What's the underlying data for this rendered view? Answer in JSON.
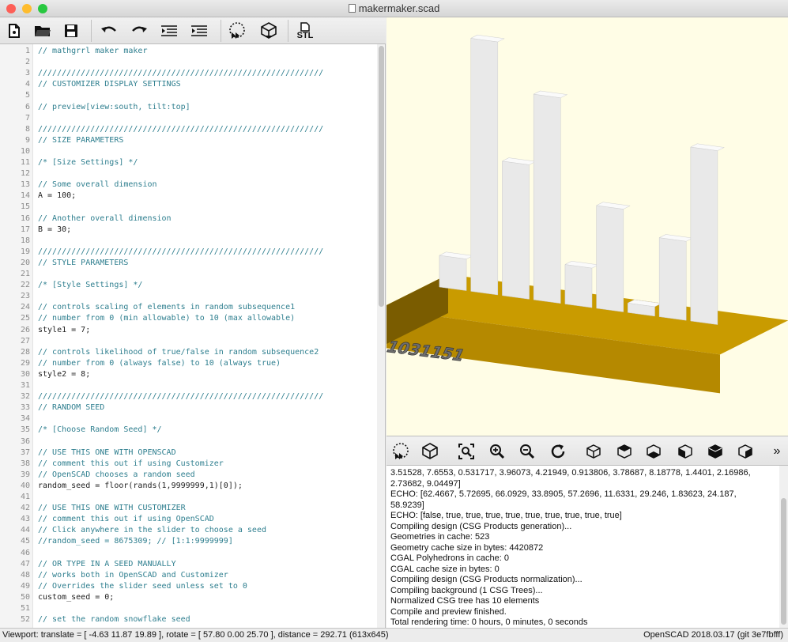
{
  "window": {
    "title": "makermaker.scad"
  },
  "colors": {
    "viewport_bg": "#fffde6",
    "base": "#c99b00",
    "bars": "#e6e6e6",
    "close": "#fd5f57",
    "minimize": "#febc2e",
    "zoom": "#28c840"
  },
  "editor_toolbar": {
    "icons": [
      "new-file-icon",
      "open-folder-icon",
      "save-icon",
      "undo-icon",
      "redo-icon",
      "unindent-icon",
      "indent-icon",
      "preview-icon",
      "render-icon",
      "export-stl-icon"
    ],
    "stl_label": "STL"
  },
  "editor": {
    "lines": [
      {
        "n": "1",
        "t": "// mathgrrl maker maker",
        "k": "comment"
      },
      {
        "n": "2",
        "t": "",
        "k": "plain"
      },
      {
        "n": "3",
        "t": "////////////////////////////////////////////////////////////",
        "k": "comment"
      },
      {
        "n": "4",
        "t": "// CUSTOMIZER DISPLAY SETTINGS",
        "k": "comment"
      },
      {
        "n": "5",
        "t": "",
        "k": "plain"
      },
      {
        "n": "6",
        "t": "// preview[view:south, tilt:top]",
        "k": "comment"
      },
      {
        "n": "7",
        "t": "",
        "k": "plain"
      },
      {
        "n": "8",
        "t": "////////////////////////////////////////////////////////////",
        "k": "comment"
      },
      {
        "n": "9",
        "t": "// SIZE PARAMETERS",
        "k": "comment"
      },
      {
        "n": "10",
        "t": "",
        "k": "plain"
      },
      {
        "n": "11",
        "t": "/* [Size Settings] */",
        "k": "comment"
      },
      {
        "n": "12",
        "t": "",
        "k": "plain"
      },
      {
        "n": "13",
        "t": "// Some overall dimension",
        "k": "comment"
      },
      {
        "n": "14",
        "t": "A = 100;",
        "k": "plain"
      },
      {
        "n": "15",
        "t": "",
        "k": "plain"
      },
      {
        "n": "16",
        "t": "// Another overall dimension",
        "k": "comment"
      },
      {
        "n": "17",
        "t": "B = 30;",
        "k": "plain"
      },
      {
        "n": "18",
        "t": "",
        "k": "plain"
      },
      {
        "n": "19",
        "t": "////////////////////////////////////////////////////////////",
        "k": "comment"
      },
      {
        "n": "20",
        "t": "// STYLE PARAMETERS",
        "k": "comment"
      },
      {
        "n": "21",
        "t": "",
        "k": "plain"
      },
      {
        "n": "22",
        "t": "/* [Style Settings] */",
        "k": "comment"
      },
      {
        "n": "23",
        "t": "",
        "k": "plain"
      },
      {
        "n": "24",
        "t": "// controls scaling of elements in random subsequence1",
        "k": "comment"
      },
      {
        "n": "25",
        "t": "// number from 0 (min allowable) to 10 (max allowable)",
        "k": "comment"
      },
      {
        "n": "26",
        "t": "style1 = 7;",
        "k": "plain"
      },
      {
        "n": "27",
        "t": "",
        "k": "plain"
      },
      {
        "n": "28",
        "t": "// controls likelihood of true/false in random subsequence2",
        "k": "comment"
      },
      {
        "n": "29",
        "t": "// number from 0 (always false) to 10 (always true)",
        "k": "comment"
      },
      {
        "n": "30",
        "t": "style2 = 8;",
        "k": "plain"
      },
      {
        "n": "31",
        "t": "",
        "k": "plain"
      },
      {
        "n": "32",
        "t": "////////////////////////////////////////////////////////////",
        "k": "comment"
      },
      {
        "n": "33",
        "t": "// RANDOM SEED",
        "k": "comment"
      },
      {
        "n": "34",
        "t": "",
        "k": "plain"
      },
      {
        "n": "35",
        "t": "/* [Choose Random Seed] */",
        "k": "comment"
      },
      {
        "n": "36",
        "t": "",
        "k": "plain"
      },
      {
        "n": "37",
        "t": "// USE THIS ONE WITH OPENSCAD",
        "k": "comment"
      },
      {
        "n": "38",
        "t": "// comment this out if using Customizer",
        "k": "comment"
      },
      {
        "n": "39",
        "t": "// OpenSCAD chooses a random seed",
        "k": "comment"
      },
      {
        "n": "40",
        "t": "random_seed = floor(rands(1,9999999,1)[0]);",
        "k": "plain"
      },
      {
        "n": "41",
        "t": "",
        "k": "plain"
      },
      {
        "n": "42",
        "t": "// USE THIS ONE WITH CUSTOMIZER",
        "k": "comment"
      },
      {
        "n": "43",
        "t": "// comment this out if using OpenSCAD",
        "k": "comment"
      },
      {
        "n": "44",
        "t": "// Click anywhere in the slider to choose a seed",
        "k": "comment"
      },
      {
        "n": "45",
        "t": "//random_seed = 8675309; // [1:1:9999999]",
        "k": "comment"
      },
      {
        "n": "46",
        "t": "",
        "k": "plain"
      },
      {
        "n": "47",
        "t": "// OR TYPE IN A SEED MANUALLY",
        "k": "comment"
      },
      {
        "n": "48",
        "t": "// works both in OpenSCAD and Customizer",
        "k": "comment"
      },
      {
        "n": "49",
        "t": "// Overrides the slider seed unless set to 0",
        "k": "comment"
      },
      {
        "n": "50",
        "t": "custom_seed = 0;",
        "k": "plain"
      },
      {
        "n": "51",
        "t": "",
        "k": "plain"
      },
      {
        "n": "52",
        "t": "// set the random snowflake seed",
        "k": "comment"
      }
    ]
  },
  "viewport": {
    "seed_label": "1031151",
    "bar_heights": [
      2,
      16,
      8.5,
      13,
      2.5,
      6.5,
      0.6,
      5,
      11
    ]
  },
  "viewport_toolbar": {
    "icons": [
      "preview-icon",
      "render-icon",
      "view-all-icon",
      "zoom-in-icon",
      "zoom-out-icon",
      "reset-view-icon",
      "view-right-icon",
      "view-top-icon",
      "view-bottom-icon",
      "view-left-icon",
      "view-front-icon",
      "view-back-icon"
    ],
    "more": "»"
  },
  "console": {
    "lines": [
      "3.51528, 7.6553, 0.531717, 3.96073, 4.21949, 0.913806, 3.78687, 8.18778, 1.4401, 2.16986,",
      "2.73682, 9.04497]",
      "ECHO: [62.4667, 5.72695, 66.0929, 33.8905, 57.2696, 11.6331, 29.246, 1.83623, 24.187,",
      "58.9239]",
      "ECHO: [false, true, true, true, true, true, true, true, true, true]",
      "Compiling design (CSG Products generation)...",
      "Geometries in cache: 523",
      "Geometry cache size in bytes: 4420872",
      "CGAL Polyhedrons in cache: 0",
      "CGAL cache size in bytes: 0",
      "Compiling design (CSG Products normalization)...",
      "Compiling background (1 CSG Trees)...",
      "Normalized CSG tree has 10 elements",
      "Compile and preview finished.",
      "Total rendering time: 0 hours, 0 minutes, 0 seconds"
    ]
  },
  "status": {
    "left": "Viewport: translate = [ -4.63 11.87 19.89 ], rotate = [ 57.80 0.00 25.70 ], distance = 292.71 (613x645)",
    "right": "OpenSCAD 2018.03.17 (git 3e7fbfff)"
  }
}
